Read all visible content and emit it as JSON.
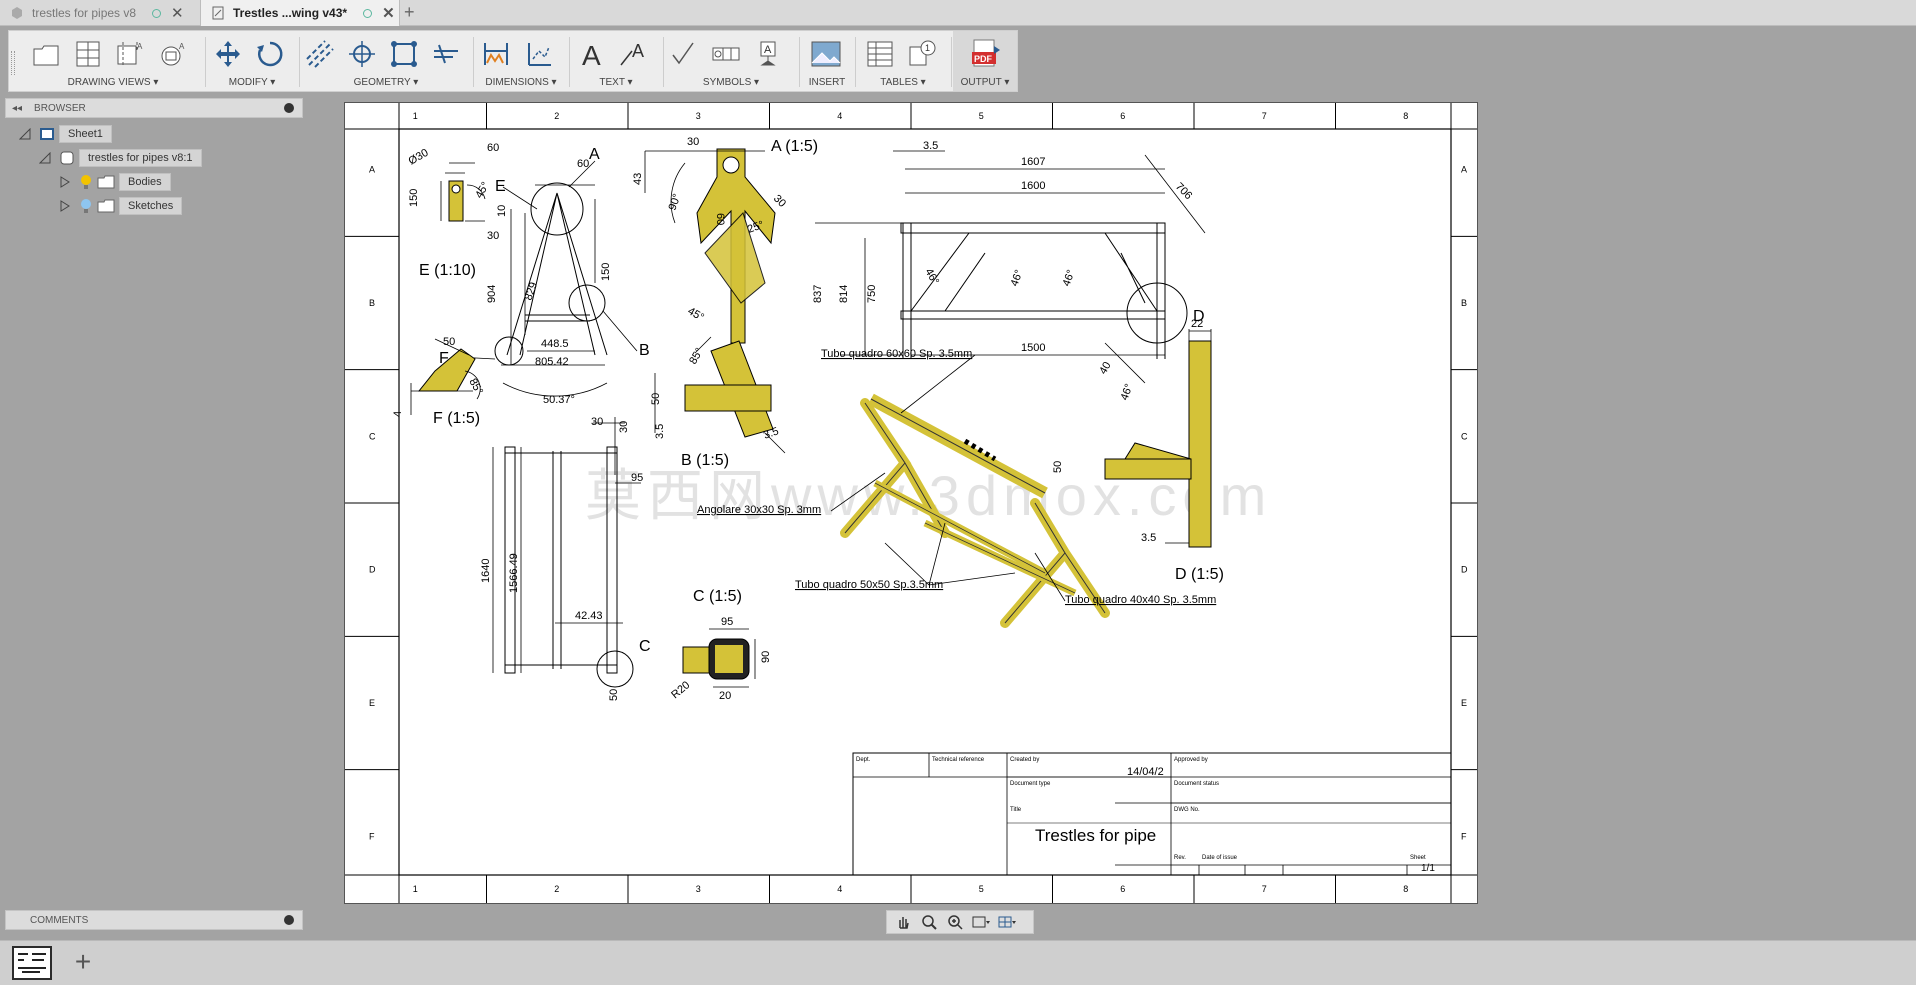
{
  "tabs": [
    {
      "label": "trestles for pipes v8",
      "active": false
    },
    {
      "label": "Trestles ...wing v43*",
      "active": true
    }
  ],
  "toolbar": {
    "groups": [
      {
        "label": "DRAWING VIEWS ▾"
      },
      {
        "label": "MODIFY ▾"
      },
      {
        "label": "GEOMETRY ▾"
      },
      {
        "label": "DIMENSIONS ▾"
      },
      {
        "label": "TEXT ▾"
      },
      {
        "label": "SYMBOLS ▾"
      },
      {
        "label": "INSERT"
      },
      {
        "label": "TABLES ▾"
      },
      {
        "label": "OUTPUT ▾"
      }
    ],
    "text_icon": "A",
    "pdf_badge": "PDF"
  },
  "browser": {
    "title": "BROWSER",
    "items": [
      {
        "label": "Sheet1"
      },
      {
        "label": "trestles for pipes v8:1"
      },
      {
        "label": "Bodies"
      },
      {
        "label": "Sketches"
      }
    ]
  },
  "comments": {
    "title": "COMMENTS"
  },
  "drawing": {
    "border_cols": [
      "1",
      "2",
      "3",
      "4",
      "5",
      "6",
      "7",
      "8"
    ],
    "border_rows": [
      "A",
      "B",
      "C",
      "D",
      "E",
      "F"
    ],
    "views": {
      "E_label": "E (1:10)",
      "A_label": "A (1:5)",
      "F_label": "F (1:5)",
      "B_label": "B (1:5)",
      "C_label": "C (1:5)",
      "D_label": "D (1:5)",
      "callout_E": "E",
      "callout_A": "A",
      "callout_B": "B",
      "callout_F": "F",
      "callout_C": "C",
      "callout_D": "D"
    },
    "dims": {
      "e_dia": "Ø30",
      "e_60": "60",
      "e_150": "150",
      "e_45": "45°",
      "e_10": "10",
      "e_30": "30",
      "front_60": "60",
      "front_150": "150",
      "front_904": "904",
      "front_829": "829",
      "front_4485": "448.5",
      "front_80542": "805.42",
      "front_angle": "50.37°",
      "a_30": "30",
      "a_43": "43",
      "a_90": "90°",
      "a_60": "60",
      "a_30b": "30",
      "a_25": "25°",
      "a_45": "45°",
      "side_35": "3.5",
      "side_1607": "1607",
      "side_1600": "1600",
      "side_706": "706",
      "side_837": "837",
      "side_814": "814",
      "side_750": "750",
      "side_46a": "46°",
      "side_46b": "46°",
      "side_46c": "46°",
      "side_1500": "1500",
      "f_50": "50",
      "f_85": "85°",
      "f_4": "4",
      "b_85": "85°",
      "b_50": "50",
      "b_35": "3.5",
      "b_35b": "3.5",
      "top_30": "30",
      "top_30b": "30",
      "top_95": "95",
      "top_1640": "1640",
      "top_156649": "1566.49",
      "top_4243": "42.43",
      "top_50": "50",
      "c_95": "95",
      "c_90": "90",
      "c_r20": "R20",
      "c_20": "20",
      "d_22": "22",
      "d_40": "40",
      "d_46": "46°",
      "d_50": "50",
      "d_35": "3.5"
    },
    "notes": {
      "tubo60": "Tubo quadro 60x60 Sp. 3.5mm",
      "angolare": "Angolare 30x30 Sp. 3mm",
      "tubo50": "Tubo quadro 50x50 Sp.3.5mm",
      "tubo40": "Tubo quadro 40x40 Sp. 3.5mm"
    },
    "watermark": "莫西网www.3dmox.com",
    "title_block": {
      "dept": "Dept.",
      "tech_ref": "Technical reference",
      "created_by": "Created by",
      "approved_by": "Approved by",
      "date": "14/04/2",
      "doc_type": "Document type",
      "doc_status": "Document status",
      "title_lbl": "Title",
      "dwg_no": "DWG No.",
      "title": "Trestles for pipe",
      "rev": "Rev.",
      "date_issue": "Date of issue",
      "sheet_lbl": "Sheet",
      "sheet": "1/1"
    }
  },
  "colors": {
    "part_fill": "#d4c238",
    "accent_red": "#d32f2f"
  }
}
